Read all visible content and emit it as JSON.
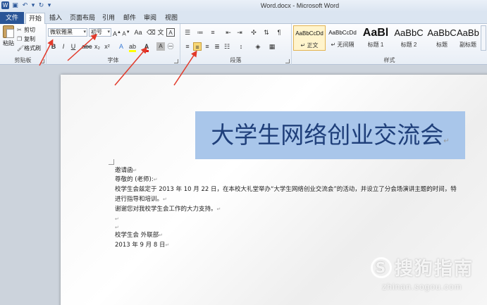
{
  "window": {
    "title": "Word.docx - Microsoft Word"
  },
  "tabs": {
    "file": "文件",
    "items": [
      "开始",
      "插入",
      "页面布局",
      "引用",
      "邮件",
      "审阅",
      "视图"
    ]
  },
  "clipboard": {
    "paste_label": "粘贴",
    "cut_label": "剪切",
    "copy_label": "复制",
    "format_painter_label": "格式刷",
    "group_label": "剪贴板"
  },
  "font": {
    "font_name": "微软雅黑",
    "font_size": "初号",
    "group_label": "字体"
  },
  "paragraph": {
    "group_label": "段落"
  },
  "styles": {
    "items": [
      {
        "sample": "AaBbCcDd",
        "name": "↵ 正文"
      },
      {
        "sample": "AaBbCcDd",
        "name": "↵ 无间隔"
      },
      {
        "sample": "AaBl",
        "name": "标题 1"
      },
      {
        "sample": "AaBbC",
        "name": "标题 2"
      },
      {
        "sample": "AaBbC",
        "name": "标题"
      },
      {
        "sample": "AaBbC",
        "name": "副标题"
      }
    ],
    "group_label": "样式"
  },
  "document": {
    "heading": "大学生网络创业交流会",
    "lines": [
      "邀请函",
      "尊敬的            (老师):",
      "校学生会兹定于 2013 年 10 月 22 日，在本校大礼堂举办“大学生网络创业交流会”的活动，并设立了分会场演讲主题的时间，特",
      "进行指导和培训。",
      "谢谢您对我校学生会工作的大力支持。",
      "",
      "",
      "校学生会 外联部",
      "2013 年 9 月 8 日"
    ]
  },
  "watermark": {
    "brand": "搜狗指南",
    "url": "zhinan.sogou.com"
  },
  "colors": {
    "file_tab": "#2a5597",
    "heading_text": "#1f3f7a",
    "selection": "#a9c6ea",
    "arrows": "#e23a2a"
  }
}
